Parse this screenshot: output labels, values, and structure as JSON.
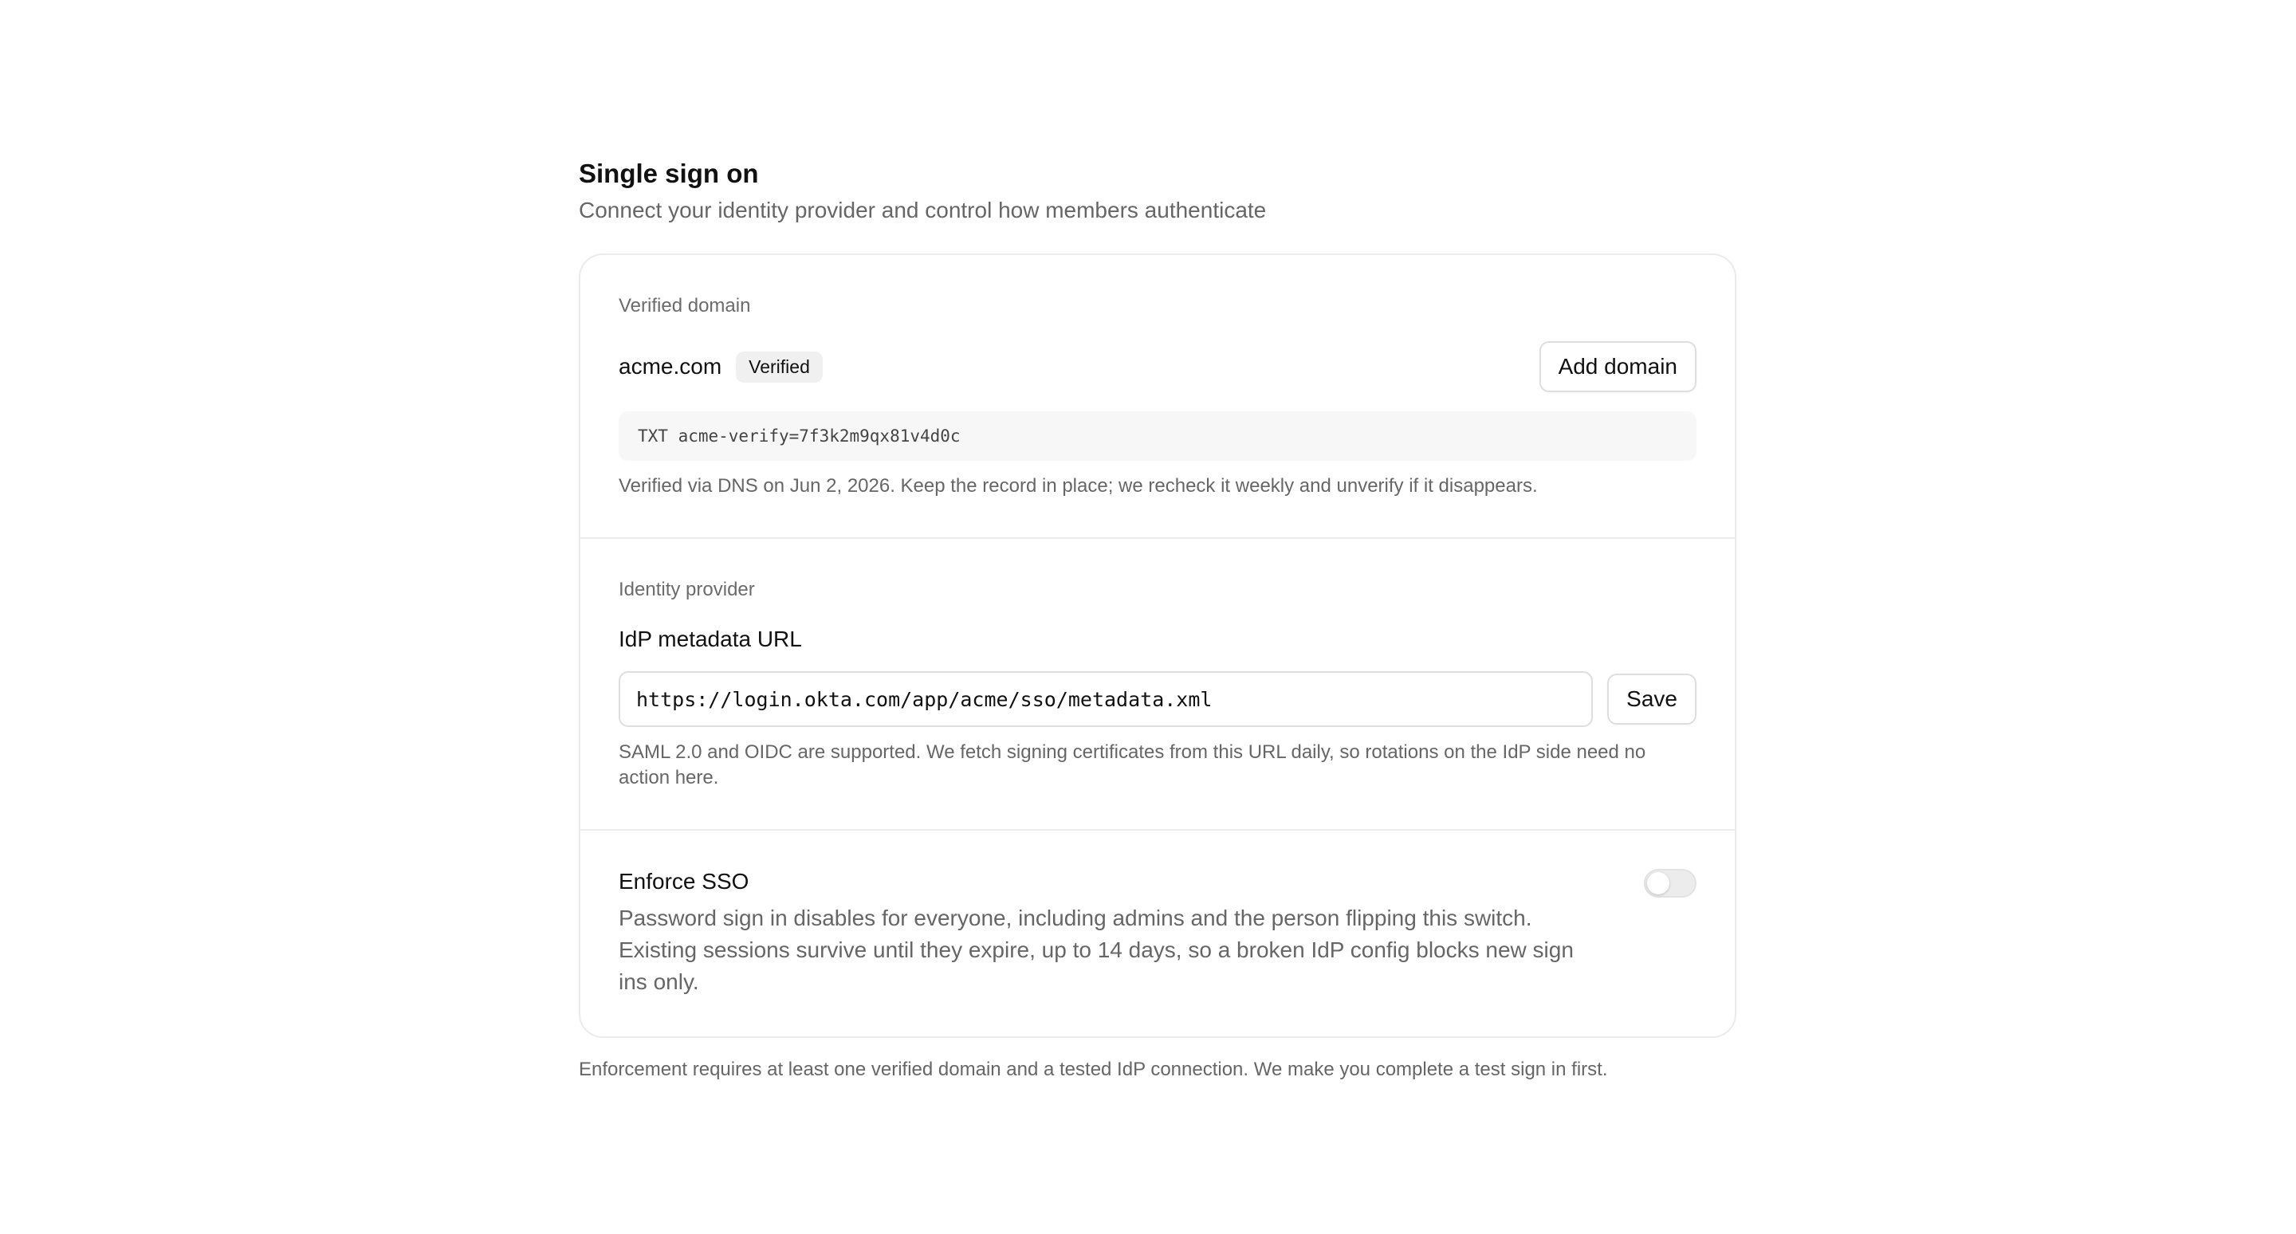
{
  "header": {
    "title": "Single sign on",
    "subtitle": "Connect your identity provider and control how members authenticate"
  },
  "domain_section": {
    "label": "Verified domain",
    "domain": "acme.com",
    "badge": "Verified",
    "add_button": "Add domain",
    "txt_record": "TXT acme-verify=7f3k2m9qx81v4d0c",
    "help": "Verified via DNS on Jun 2, 2026. Keep the record in place; we recheck it weekly and unverify if it disappears."
  },
  "idp_section": {
    "label": "Identity provider",
    "field_label": "IdP metadata URL",
    "url_value": "https://login.okta.com/app/acme/sso/metadata.xml",
    "save_button": "Save",
    "help": "SAML 2.0 and OIDC are supported. We fetch signing certificates from this URL daily, so rotations on the IdP side need no action here."
  },
  "enforce_section": {
    "title": "Enforce SSO",
    "description": "Password sign in disables for everyone, including admins and the person flipping this switch. Existing sessions survive until they expire, up to 14 days, so a broken IdP config blocks new sign ins only.",
    "toggle_on": false
  },
  "footnote": "Enforcement requires at least one verified domain and a tested IdP connection. We make you complete a test sign in first."
}
